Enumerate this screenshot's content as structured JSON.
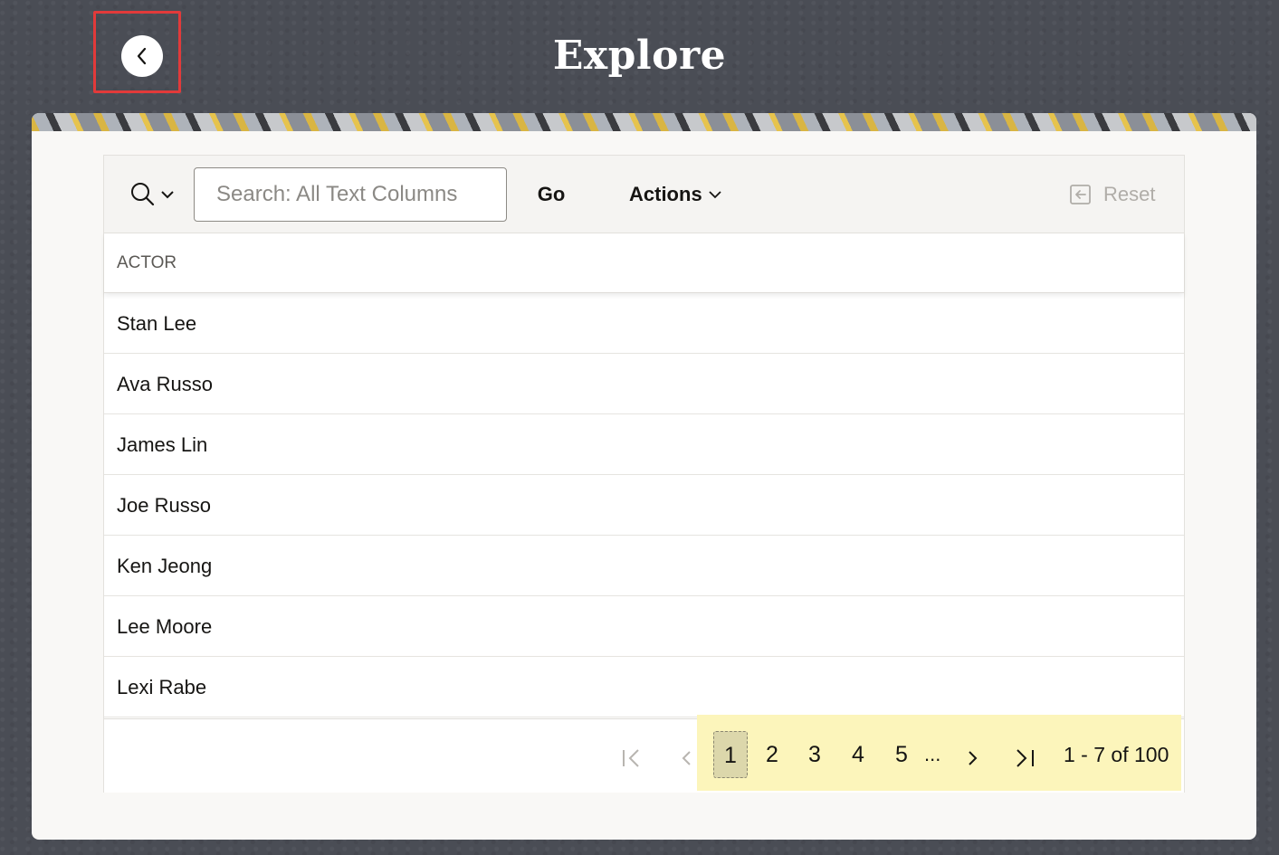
{
  "header": {
    "title": "Explore",
    "back_icon": "chevron-left-icon"
  },
  "toolbar": {
    "search_icon": "search-icon",
    "search_placeholder": "Search: All Text Columns",
    "search_value": "",
    "go_label": "Go",
    "actions_label": "Actions",
    "reset_label": "Reset"
  },
  "table": {
    "columns": [
      "ACTOR"
    ],
    "rows": [
      "Stan Lee",
      "Ava Russo",
      "James Lin",
      "Joe Russo",
      "Ken Jeong",
      "Lee Moore",
      "Lexi Rabe"
    ]
  },
  "pagination": {
    "pages": [
      "1",
      "2",
      "3",
      "4",
      "5"
    ],
    "current_page": "1",
    "ellipsis": "...",
    "status": "1 - 7 of 100"
  },
  "colors": {
    "page_bg": "#4a4d55",
    "highlight_border": "#e23a3a",
    "pagination_highlight": "#fcf5bb"
  }
}
